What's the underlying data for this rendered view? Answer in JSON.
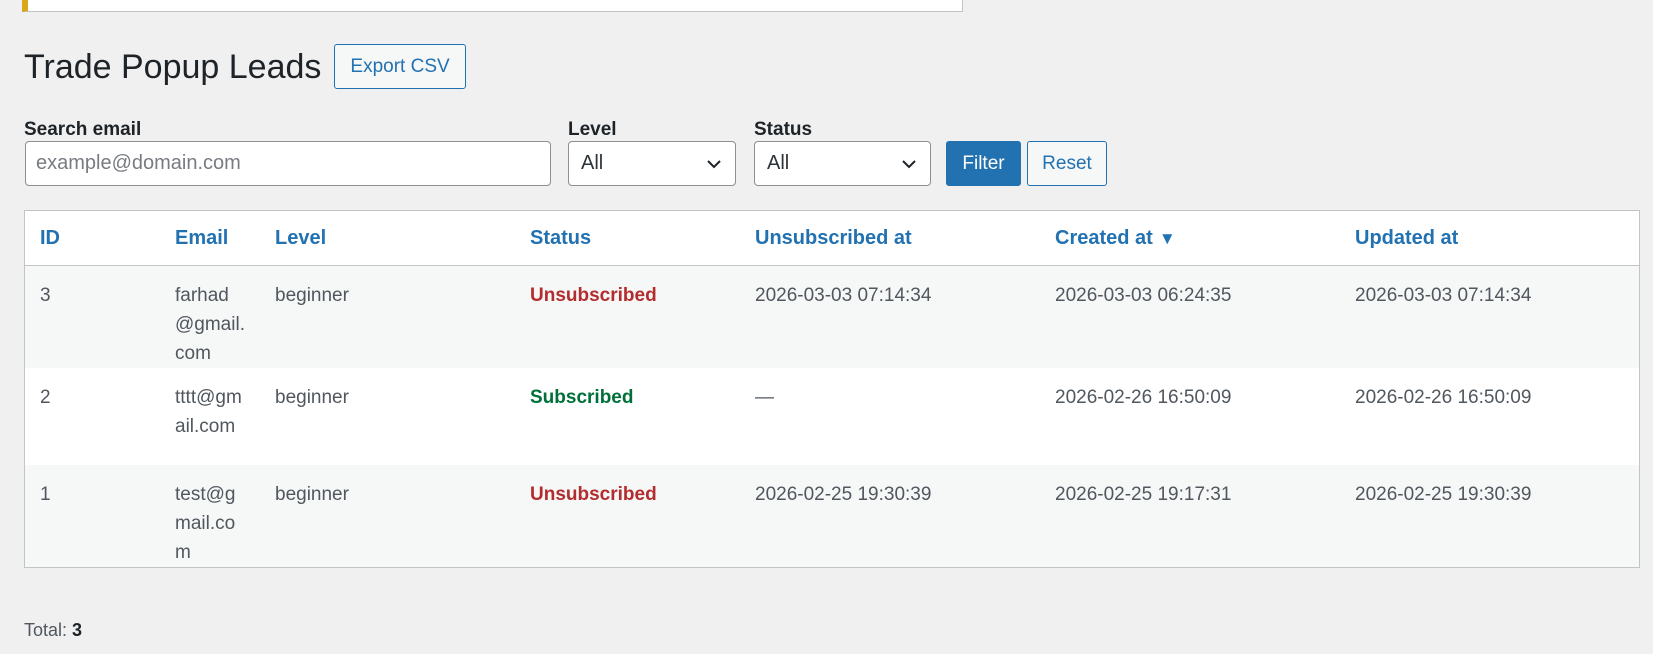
{
  "page": {
    "title": "Trade Popup Leads",
    "export_label": "Export CSV"
  },
  "filters": {
    "search_label": "Search email",
    "search_placeholder": "example@domain.com",
    "search_value": "",
    "level_label": "Level",
    "level_value": "All",
    "status_label": "Status",
    "status_value": "All",
    "filter_label": "Filter",
    "reset_label": "Reset"
  },
  "table": {
    "headers": {
      "id": "ID",
      "email": "Email",
      "level": "Level",
      "status": "Status",
      "unsubscribed_at": "Unsubscribed at",
      "created_at": "Created at",
      "updated_at": "Updated at"
    },
    "sort_icon": "▼",
    "rows": [
      {
        "id": "3",
        "email": "farhad@gmail.com",
        "level": "beginner",
        "status": "Unsubscribed",
        "unsubscribed_at": "2026-03-03 07:14:34",
        "created_at": "2026-03-03 06:24:35",
        "updated_at": "2026-03-03 07:14:34"
      },
      {
        "id": "2",
        "email": "tttt@gmail.com",
        "level": "beginner",
        "status": "Subscribed",
        "unsubscribed_at": "—",
        "created_at": "2026-02-26 16:50:09",
        "updated_at": "2026-02-26 16:50:09"
      },
      {
        "id": "1",
        "email": "test@gmail.com",
        "level": "beginner",
        "status": "Unsubscribed",
        "unsubscribed_at": "2026-02-25 19:30:39",
        "created_at": "2026-02-25 19:17:31",
        "updated_at": "2026-02-25 19:30:39"
      }
    ]
  },
  "footer": {
    "total_label": "Total:",
    "total_value": "3"
  },
  "colors": {
    "accent": "#2271b1",
    "unsubscribed": "#b32d2e",
    "subscribed": "#00703a",
    "notice_border": "#dba617"
  },
  "icons": {
    "select_arrow": "chevron-down-icon",
    "sort": "sort-desc-icon"
  }
}
